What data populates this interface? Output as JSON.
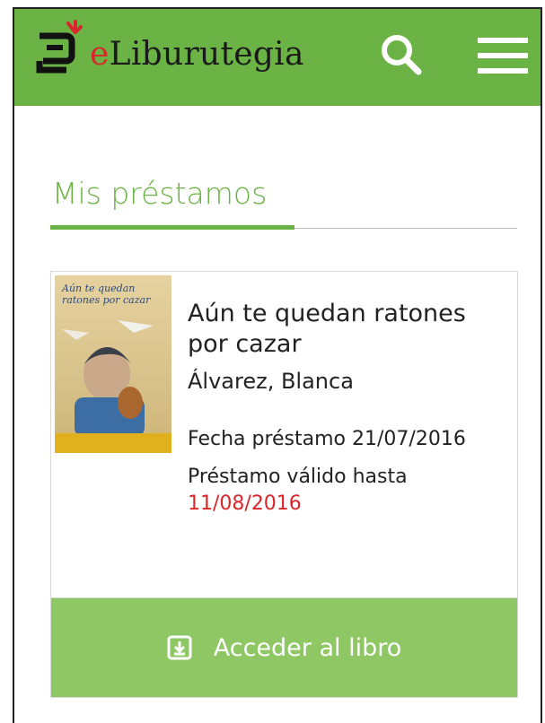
{
  "header": {
    "brand_prefix": "e",
    "brand_rest": "Liburutegia",
    "search_icon": "search-icon",
    "menu_icon": "hamburger-menu-icon",
    "color": "#6ab344"
  },
  "page": {
    "title": "Mis préstamos"
  },
  "loans": [
    {
      "cover_title": "Aún te quedan ratones por cazar",
      "title": "Aún te quedan ratones por cazar",
      "author": "Álvarez, Blanca",
      "loan_date_label": "Fecha préstamo 21/07/2016",
      "valid_until_label": "Préstamo válido hasta",
      "valid_until_date": "11/08/2016",
      "access_label": "Acceder al libro",
      "access_icon": "download-icon"
    }
  ],
  "colors": {
    "accent": "#6ab344",
    "button": "#8ec764",
    "due_date": "#d9262d"
  }
}
